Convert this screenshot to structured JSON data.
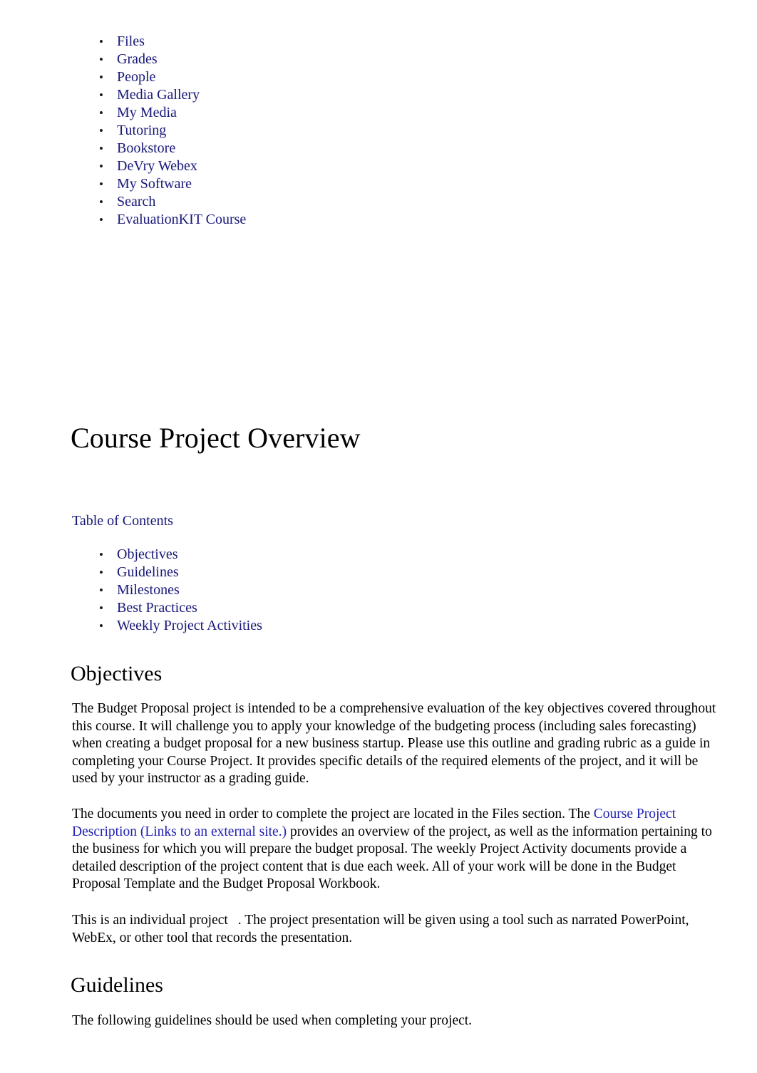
{
  "document": {
    "title": "Course Project Overview"
  },
  "course_nav": {
    "items": [
      {
        "label": "Files"
      },
      {
        "label": "Grades"
      },
      {
        "label": "People"
      },
      {
        "label": "Media Gallery"
      },
      {
        "label": "My Media"
      },
      {
        "label": "Tutoring"
      },
      {
        "label": "Bookstore"
      },
      {
        "label": "DeVry Webex"
      },
      {
        "label": "My Software"
      },
      {
        "label": "Search"
      },
      {
        "label": "EvaluationKIT Course"
      }
    ]
  },
  "table_of_contents": {
    "heading": "Table of Contents",
    "items": [
      {
        "label": "Objectives"
      },
      {
        "label": "Guidelines"
      },
      {
        "label": "Milestones"
      },
      {
        "label": "Best Practices"
      },
      {
        "label": "Weekly Project Activities"
      }
    ]
  },
  "sections": {
    "objectives": {
      "heading": "Objectives",
      "paragraph_1": "The Budget Proposal project is intended to be a comprehensive evaluation of the key objectives covered throughout this course. It will challenge you to apply your knowledge of the budgeting process (including sales forecasting) when creating a budget proposal for a new business startup. Please use this outline and grading rubric as a guide in completing your Course Project. It provides specific details of the required elements of the project, and it will be used by your instructor as a grading guide.",
      "paragraph_2_before_link": "The documents you need in order to complete the project are located in the Files section. The ",
      "paragraph_2_link": "Course Project Description (Links to an external site.)",
      "paragraph_2_after_link": " provides an overview of the project, as well as the information pertaining to the business for which you will prepare the budget proposal. The weekly Project Activity documents provide a detailed description of the project content that is due each week. All of your work will be done in the Budget Proposal Template and the Budget Proposal Workbook.",
      "paragraph_3_part_1": "This is an individual project",
      "paragraph_3_part_2": ". The project presentation will be given using a tool such as narrated PowerPoint, WebEx, or other tool that records the presentation."
    },
    "guidelines": {
      "heading": "Guidelines",
      "paragraph_1": "The following guidelines should be used when completing your project."
    }
  },
  "colors": {
    "nav_link": "#19197a",
    "inline_link": "#2222b4",
    "body_text": "#000000",
    "page_background": "#ffffff"
  }
}
